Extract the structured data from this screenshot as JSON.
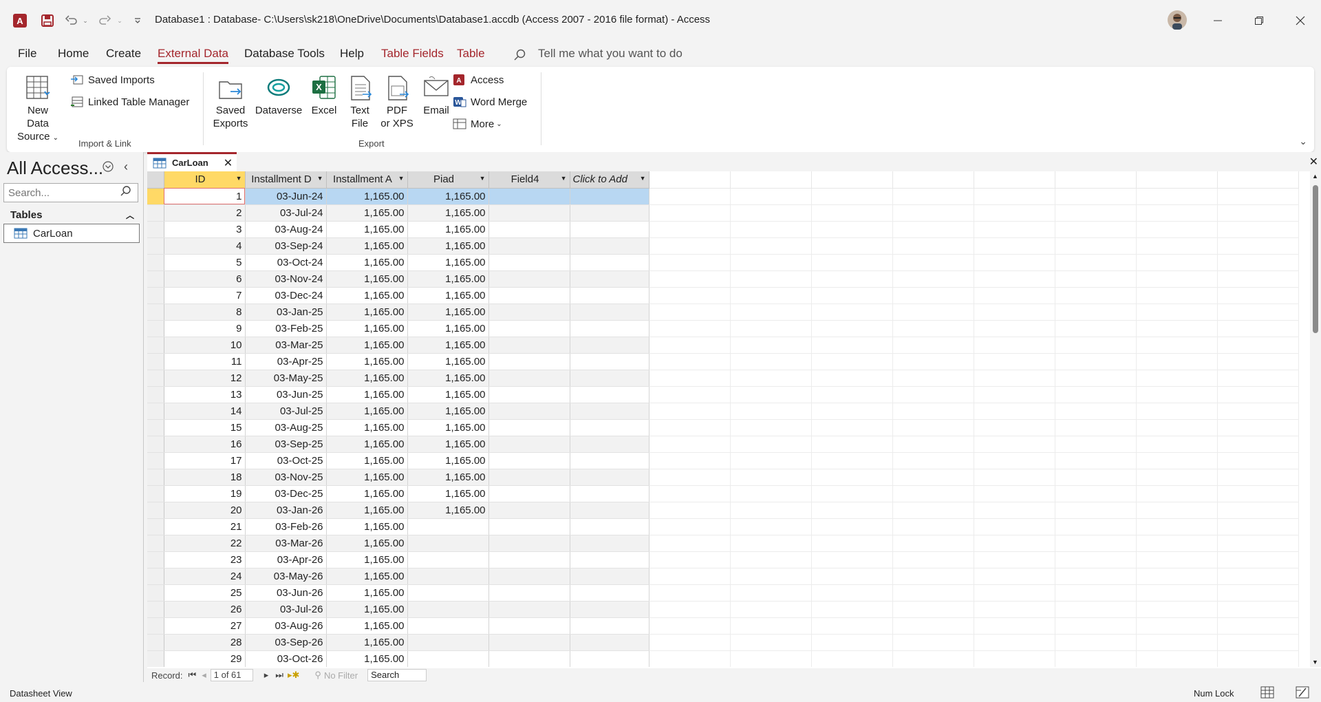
{
  "window": {
    "title": "Database1 : Database- C:\\Users\\sk218\\OneDrive\\Documents\\Database1.accdb (Access 2007 - 2016 file format)  -  Access"
  },
  "tabs": [
    {
      "label": "File"
    },
    {
      "label": "Home"
    },
    {
      "label": "Create"
    },
    {
      "label": "External Data"
    },
    {
      "label": "Database Tools"
    },
    {
      "label": "Help"
    },
    {
      "label": "Table Fields"
    },
    {
      "label": "Table"
    }
  ],
  "tellme": {
    "placeholder": "Tell me what you want to do"
  },
  "ribbon": {
    "new_data_source_1": "New Data",
    "new_data_source_2": "Source",
    "saved_imports": "Saved Imports",
    "linked_table_manager": "Linked Table Manager",
    "import_link_label": "Import & Link",
    "saved_exports_1": "Saved",
    "saved_exports_2": "Exports",
    "dataverse": "Dataverse",
    "excel": "Excel",
    "text_file_1": "Text",
    "text_file_2": "File",
    "pdf_1": "PDF",
    "pdf_2": "or XPS",
    "email": "Email",
    "access": "Access",
    "word_merge": "Word Merge",
    "more": "More",
    "export_label": "Export"
  },
  "nav": {
    "title": "All Access...",
    "search_placeholder": "Search...",
    "section": "Tables",
    "items": [
      {
        "label": "CarLoan"
      }
    ]
  },
  "document": {
    "tab_label": "CarLoan",
    "columns": [
      "ID",
      "Installment D",
      "Installment A",
      "Piad",
      "Field4",
      "Click to Add"
    ],
    "rows": [
      [
        "1",
        "03-Jun-24",
        "1,165.00",
        "1,165.00"
      ],
      [
        "2",
        "03-Jul-24",
        "1,165.00",
        "1,165.00"
      ],
      [
        "3",
        "03-Aug-24",
        "1,165.00",
        "1,165.00"
      ],
      [
        "4",
        "03-Sep-24",
        "1,165.00",
        "1,165.00"
      ],
      [
        "5",
        "03-Oct-24",
        "1,165.00",
        "1,165.00"
      ],
      [
        "6",
        "03-Nov-24",
        "1,165.00",
        "1,165.00"
      ],
      [
        "7",
        "03-Dec-24",
        "1,165.00",
        "1,165.00"
      ],
      [
        "8",
        "03-Jan-25",
        "1,165.00",
        "1,165.00"
      ],
      [
        "9",
        "03-Feb-25",
        "1,165.00",
        "1,165.00"
      ],
      [
        "10",
        "03-Mar-25",
        "1,165.00",
        "1,165.00"
      ],
      [
        "11",
        "03-Apr-25",
        "1,165.00",
        "1,165.00"
      ],
      [
        "12",
        "03-May-25",
        "1,165.00",
        "1,165.00"
      ],
      [
        "13",
        "03-Jun-25",
        "1,165.00",
        "1,165.00"
      ],
      [
        "14",
        "03-Jul-25",
        "1,165.00",
        "1,165.00"
      ],
      [
        "15",
        "03-Aug-25",
        "1,165.00",
        "1,165.00"
      ],
      [
        "16",
        "03-Sep-25",
        "1,165.00",
        "1,165.00"
      ],
      [
        "17",
        "03-Oct-25",
        "1,165.00",
        "1,165.00"
      ],
      [
        "18",
        "03-Nov-25",
        "1,165.00",
        "1,165.00"
      ],
      [
        "19",
        "03-Dec-25",
        "1,165.00",
        "1,165.00"
      ],
      [
        "20",
        "03-Jan-26",
        "1,165.00",
        "1,165.00"
      ],
      [
        "21",
        "03-Feb-26",
        "1,165.00",
        ""
      ],
      [
        "22",
        "03-Mar-26",
        "1,165.00",
        ""
      ],
      [
        "23",
        "03-Apr-26",
        "1,165.00",
        ""
      ],
      [
        "24",
        "03-May-26",
        "1,165.00",
        ""
      ],
      [
        "25",
        "03-Jun-26",
        "1,165.00",
        ""
      ],
      [
        "26",
        "03-Jul-26",
        "1,165.00",
        ""
      ],
      [
        "27",
        "03-Aug-26",
        "1,165.00",
        ""
      ],
      [
        "28",
        "03-Sep-26",
        "1,165.00",
        ""
      ],
      [
        "29",
        "03-Oct-26",
        "1,165.00",
        ""
      ]
    ]
  },
  "record_nav": {
    "label": "Record:",
    "position": "1 of 61",
    "filter": "No Filter",
    "search": "Search"
  },
  "status": {
    "view": "Datasheet View",
    "numlock": "Num Lock"
  },
  "colors": {
    "accent": "#a4262c",
    "selected_row": "#b8d7f2",
    "record_selector": "#ffd966"
  }
}
